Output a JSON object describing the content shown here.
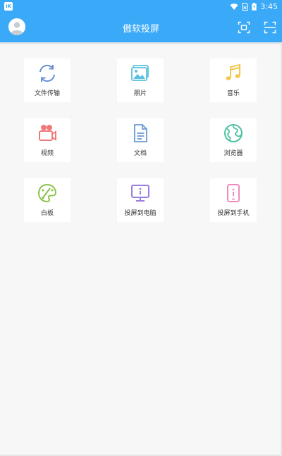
{
  "status_bar": {
    "notification_icon": "app-notification-icon",
    "notification_text": "iK",
    "time": "3:45"
  },
  "header": {
    "title": "傲软投屏",
    "avatar_icon": "avatar-icon",
    "cast_icon": "screen-cast-icon",
    "scan_icon": "scan-icon",
    "accent": "#3aa9f8"
  },
  "tiles": [
    {
      "label": "文件传输",
      "icon": "sync-icon",
      "color": "#6b8fd6"
    },
    {
      "label": "照片",
      "icon": "photo-icon",
      "color": "#5bc0de"
    },
    {
      "label": "音乐",
      "icon": "music-icon",
      "color": "#f2c94c"
    },
    {
      "label": "视频",
      "icon": "video-camera-icon",
      "color": "#f07a7a"
    },
    {
      "label": "文档",
      "icon": "document-icon",
      "color": "#6b9bd6"
    },
    {
      "label": "浏览器",
      "icon": "globe-icon",
      "color": "#4fc1a3"
    },
    {
      "label": "白板",
      "icon": "palette-icon",
      "color": "#8bc34a"
    },
    {
      "label": "投屏到电脑",
      "icon": "monitor-icon",
      "color": "#9b7fe0"
    },
    {
      "label": "投屏到手机",
      "icon": "phone-icon",
      "color": "#f08bbf"
    }
  ]
}
